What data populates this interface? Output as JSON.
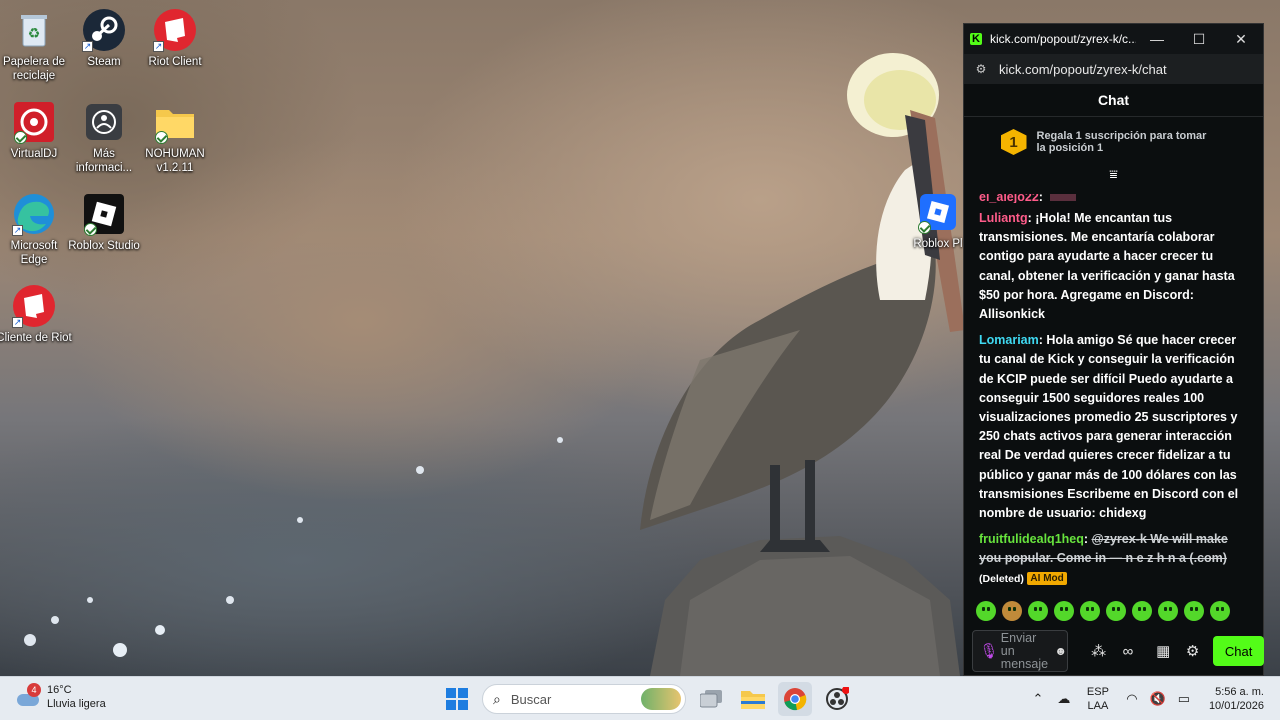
{
  "desktop": {
    "icons": [
      {
        "label": "Papelera de reciclaje",
        "icon": "recycle-bin-icon"
      },
      {
        "label": "Steam",
        "icon": "steam-icon"
      },
      {
        "label": "Riot Client",
        "icon": "riot-client-icon"
      },
      {
        "label": "VirtualDJ",
        "icon": "virtualdj-icon"
      },
      {
        "label": "Más informaci...",
        "icon": "more-info-icon"
      },
      {
        "label": "NOHUMAN v1.2.11",
        "icon": "folder-icon"
      },
      {
        "label": "Microsoft Edge",
        "icon": "edge-icon"
      },
      {
        "label": "Roblox Studio",
        "icon": "roblox-studio-icon"
      },
      {
        "label": "Cliente de Riot",
        "icon": "riot-client-icon"
      },
      {
        "label": "Roblox Pl",
        "icon": "roblox-player-icon"
      }
    ]
  },
  "popup": {
    "title": "kick.com/popout/zyrex-k/c...",
    "url": "kick.com/popout/zyrex-k/chat",
    "header": "Chat",
    "sub_banner": {
      "rank": "1",
      "text": "Regala 1 suscripción para tomar la posición 1"
    },
    "cut_message": {
      "user": "el_alejo22",
      "sep": ":"
    },
    "messages": [
      {
        "user": "Luliantg",
        "color": "#ff5c8a",
        "text": "¡Hola! Me encantan tus transmisiones. Me encantaría colaborar contigo para ayudarte a hacer crecer tu canal, obtener la verificación y ganar hasta $50 por hora. Agregame en Discord: Allisonkick"
      },
      {
        "user": "Lomariam",
        "color": "#3fd9f2",
        "text": "Hola amigo Sé que hacer crecer tu canal de Kick y conseguir la verificación de KCIP puede ser difícil Puedo ayudarte a conseguir 1500 seguidores reales 100 visualizaciones promedio 25 suscriptores y 250 chats activos para generar interacción real De verdad quieres crecer fidelizar a tu público y ganar más de 100 dólares con las transmisiones Escribeme en Discord con el nombre de usuario: chidexg"
      },
      {
        "user": "fruitfulidealq1heq",
        "color": "#67e33d",
        "text": "@zyrex-k We will make you popular. Come in — n e z h n a (.com)",
        "deleted": "(Deleted)",
        "badge": "AI Mod"
      }
    ],
    "input_placeholder": "Enviar un mensaje",
    "send_label": "Chat",
    "accent": "#53fc18"
  },
  "taskbar": {
    "weather": {
      "badge": "4",
      "temp": "16°C",
      "desc": "Lluvia ligera"
    },
    "search_placeholder": "Buscar",
    "lang": {
      "line1": "ESP",
      "line2": "LAA"
    },
    "clock": {
      "time": "5:56 a. m.",
      "date": "10/01/2026"
    }
  }
}
